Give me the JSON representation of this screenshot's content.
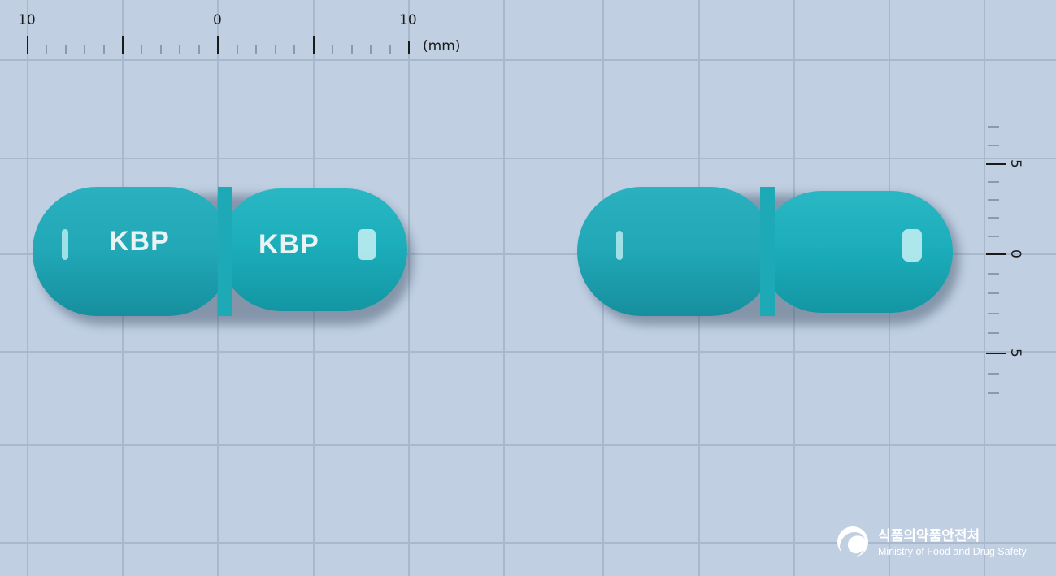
{
  "background_color": "#c0cfe2",
  "capsule_color": "#1fb0bd",
  "top_ruler": {
    "labels": [
      "10",
      "0",
      "10"
    ],
    "unit": "(mm)"
  },
  "side_ruler": {
    "labels": [
      "5",
      "0",
      "5"
    ]
  },
  "left_capsule": {
    "imprint_left": "KBP",
    "imprint_right": "KBP"
  },
  "right_capsule": {},
  "logo": {
    "icon": "mfds-taegeuk-icon",
    "korean": "식품의약품안전처",
    "english": "Ministry of Food and Drug Safety"
  }
}
